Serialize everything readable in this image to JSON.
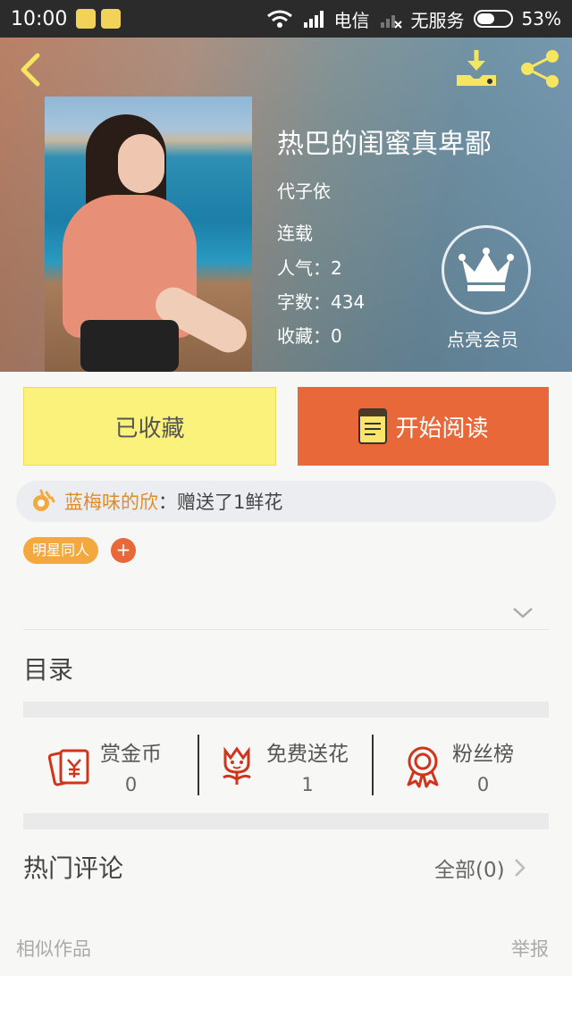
{
  "status_bar": {
    "time": "10:00",
    "carrier": "电信",
    "service": "无服务",
    "battery": "53%",
    "battery_level": 0.53
  },
  "header": {
    "icons": {
      "back": "back-arrow-icon",
      "download": "download-icon",
      "share": "share-icon"
    },
    "book": {
      "title": "热巴的闺蜜真卑鄙",
      "author": "代子依",
      "status": "连载",
      "popularity": "人气：2",
      "word_count": "字数：434",
      "favorites": "收藏：0"
    },
    "vip_label": "点亮会员"
  },
  "actions": {
    "favorited_label": "已收藏",
    "read_label": "开始阅读"
  },
  "gift_bar": {
    "user": "蓝梅味的欣",
    "message": "：赠送了1鲜花"
  },
  "tags": [
    "明星同人"
  ],
  "tag_add_symbol": "+",
  "toc_label": "目录",
  "stats": [
    {
      "label": "赏金币",
      "value": "0",
      "icon": "red-envelope-icon"
    },
    {
      "label": "免费送花",
      "value": "1",
      "icon": "flower-icon"
    },
    {
      "label": "粉丝榜",
      "value": "0",
      "icon": "medal-icon"
    }
  ],
  "comments": {
    "title": "热门评论",
    "all_label": "全部(0)"
  },
  "footer": {
    "similar": "相似作品",
    "report": "举报"
  },
  "colors": {
    "accent_orange": "#e8683a",
    "fav_yellow": "#fbf27c",
    "tag_orange": "#f4a93e",
    "username_orange": "#e08c2a",
    "icon_red": "#d0341c",
    "header_icon_yellow": "#f5e560"
  }
}
